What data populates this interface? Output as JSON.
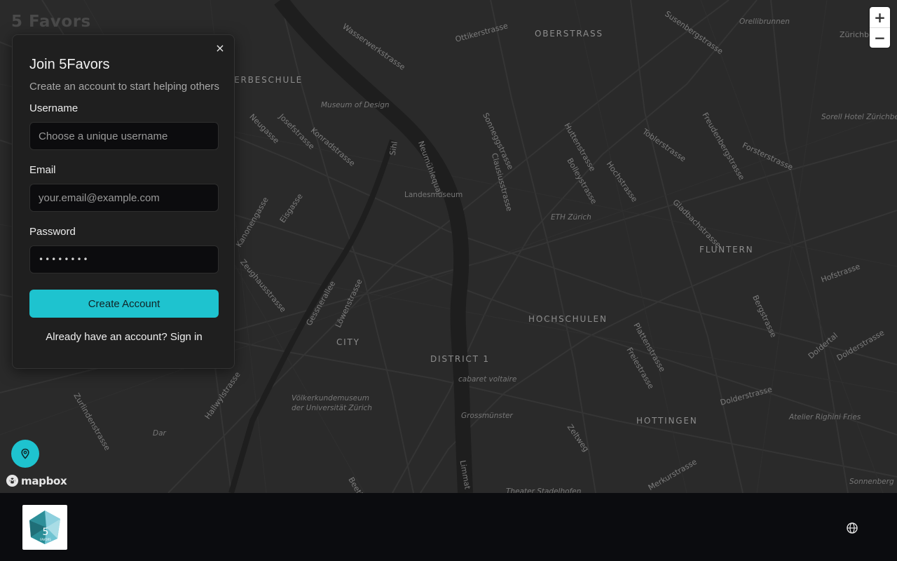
{
  "app": {
    "title": "5 Favors"
  },
  "map": {
    "labels": {
      "oberstrass": "OBERSTRASS",
      "fluntern": "FLUNTERN",
      "hochschulen": "HOCHSCHULEN",
      "district1": "DISTRICT 1",
      "city": "CITY",
      "hottingen": "HOTTINGEN",
      "gewerbeschule": "GEWERBESCHULE",
      "wasserwerkstrasse": "Wasserwerkstrasse",
      "ottikerstrasse": "Ottikerstrasse",
      "susenbergstrasse": "Susenbergstrasse",
      "orellibrunnen": "Orellibrunnen",
      "zuerichberg": "Zürichberg",
      "museum_design": "Museum of Design",
      "neugasse": "Neugasse",
      "josefstrasse": "Josefstrasse",
      "konradstrasse": "Konradstrasse",
      "sihl": "Sihl",
      "neumuehlequai": "Neumühlequai",
      "sonneggstrasse": "Sonneggstrasse",
      "clausiusstrasse": "Clausiusstrasse",
      "huttenstrasse": "Huttenstrasse",
      "bolleystrasse": "Bolleystrasse",
      "hochstrasse": "Hochstrasse",
      "toblerstrasse": "Toblerstrasse",
      "freudenbergstrasse": "Freudenbergstrasse",
      "forsterstrasse": "Forsterstrasse",
      "sorell": "Sorell Hotel Zürichberg",
      "landesmuseum": "Landesmuseum",
      "eth": "ETH Zürich",
      "gladbachstrasse": "Gladbachstrasse",
      "hofstrasse": "Hofstrasse",
      "eisgasse": "Eisgasse",
      "kanonengasse": "Kanonengasse",
      "zeughausstrasse": "Zeughausstrasse",
      "gessnerallee": "Gessnerallee",
      "loewenstrasse": "Löwenstrasse",
      "plattenstrasse": "Plattenstrasse",
      "freiestrasse": "Freiestrasse",
      "bergstrasse": "Bergstrasse",
      "doldertal": "Doldertal",
      "dolderstrasse": "Dolderstrasse",
      "dolderstrasse2": "Dolderstrasse",
      "cabaret": "cabaret voltaire",
      "grossmuenster": "Grossmünster",
      "voelkerkunde1": "Völkerkundemuseum",
      "voelkerkunde2": "der Universität Zürich",
      "zeltweg": "Zeltweg",
      "atelier": "Atelier Righini Fries",
      "merkurstrasse": "Merkurstrasse",
      "sonnenberg": "Sonnenberg",
      "theater": "Theater Stadelhofen",
      "limmat": "Limmat",
      "zurlindenstrasse": "Zurlindenstrasse",
      "hallwylstrasse": "Hallwylstrasse",
      "dar": "Dar",
      "beethovenstrasse": "Beethov"
    },
    "zoom_in": "+",
    "zoom_out": "−",
    "attribution": "mapbox"
  },
  "signup": {
    "close": "×",
    "title": "Join 5Favors",
    "subtitle": "Create an account to start helping others",
    "username_label": "Username",
    "username_placeholder": "Choose a unique username",
    "email_label": "Email",
    "email_placeholder": "your.email@example.com",
    "password_label": "Password",
    "password_value": "password",
    "submit": "Create Account",
    "signin": "Already have an account? Sign in"
  },
  "footer": {
    "logo_text": "5",
    "logo_subtext": "FAVORS"
  },
  "colors": {
    "accent": "#1ec3cf",
    "panel_bg": "#1f1f1f",
    "map_bg": "#2a2a2a"
  }
}
